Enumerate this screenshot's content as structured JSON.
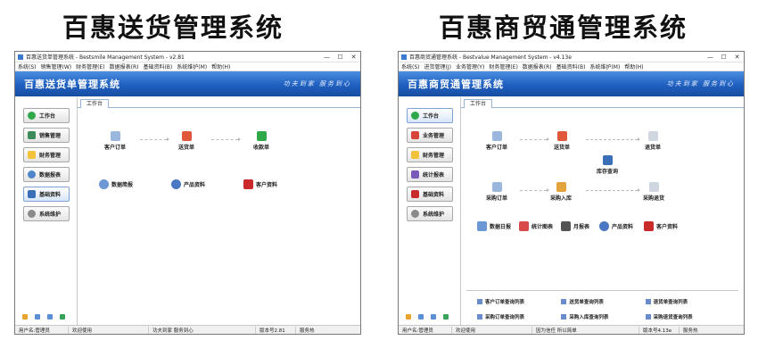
{
  "left": {
    "heading": "百惠送货管理系统",
    "window_title": "百惠送货单管理系统 - Bestsmile Management System - v2.81",
    "menu": [
      "系统(S)",
      "销售管理(W)",
      "财务管理(E)",
      "数据报表(R)",
      "基础资料(B)",
      "系统维护(M)",
      "帮助(H)"
    ],
    "banner_title": "百惠送货单管理系统",
    "banner_slogan": "功夫到家 服务到心",
    "tab": "工作台",
    "sidebar": [
      "工作台",
      "销售管理",
      "财务管理",
      "数据报表",
      "基础资料",
      "系统维护"
    ],
    "nodes": {
      "customer_order": "客户订单",
      "delivery": "送货单",
      "receipt": "收款单",
      "data_brief": "数据简报",
      "product_info": "产品资料",
      "customer_info": "客户资料"
    },
    "status": [
      "用户名:管理员",
      "欢迎使用",
      "功夫到家 服务到心",
      "版本号2.81",
      "服务热"
    ]
  },
  "right": {
    "heading": "百惠商贸通管理系统",
    "window_title": "百惠商贸通管理系统 - Bestvalue Management System - v4.13e",
    "menu": [
      "系统(S)",
      "进货管理(J)",
      "业务管理(Y)",
      "财务管理(E)",
      "数据报表(R)",
      "基础资料(B)",
      "系统维护(M)",
      "帮助(H)"
    ],
    "banner_title": "百惠商贸通管理系统",
    "banner_slogan": "功夫到家 服务到心",
    "tab": "工作台",
    "sidebar": [
      "工作台",
      "业务管理",
      "财务管理",
      "统计报表",
      "基础资料",
      "系统维护"
    ],
    "nodes": {
      "customer_order": "客户订单",
      "delivery": "送货单",
      "return": "退货单",
      "inventory": "库存查询",
      "purchase_order": "采购订单",
      "purchase_in": "采购入库",
      "purchase_return": "采购退货",
      "daily_report": "数据日报",
      "stats_chart": "统计图表",
      "monthly_report": "月报表",
      "product_info": "产品资料",
      "customer_info": "客户资料"
    },
    "reports": [
      "客户订单查询列表",
      "送货单查询列表",
      "退货单查询列表",
      "采购订单查询列表",
      "采购入库查询列表",
      "采购退货查询列表"
    ],
    "status": [
      "用户名:管理员",
      "欢迎使用",
      "因为信任 所以简单",
      "版本号4.13e",
      "服务热"
    ]
  },
  "window_buttons": [
    "—",
    "☐",
    "✕"
  ],
  "colors": {
    "banner": "#1f5fbf",
    "accent": "#3a7ad0"
  }
}
